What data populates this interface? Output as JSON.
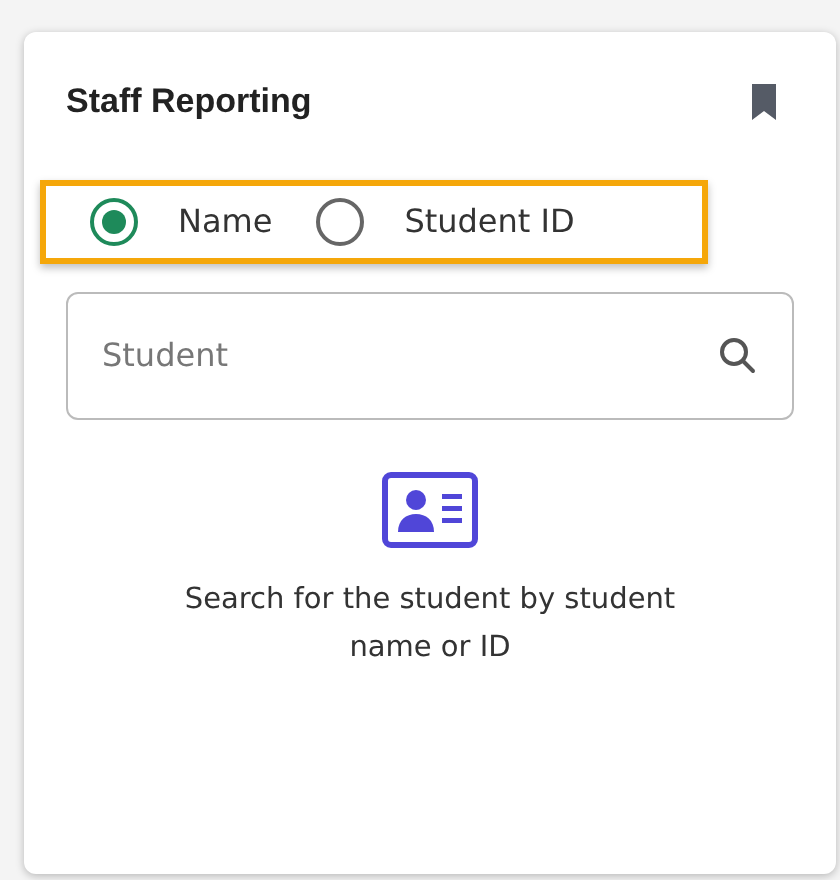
{
  "card": {
    "title": "Staff Reporting",
    "bookmarked": true
  },
  "search_mode": {
    "highlighted": true,
    "options": [
      {
        "label": "Name",
        "selected": true
      },
      {
        "label": "Student ID",
        "selected": false
      }
    ]
  },
  "search": {
    "placeholder": "Student"
  },
  "empty_state": {
    "message": "Search for the student by student name or ID"
  }
}
